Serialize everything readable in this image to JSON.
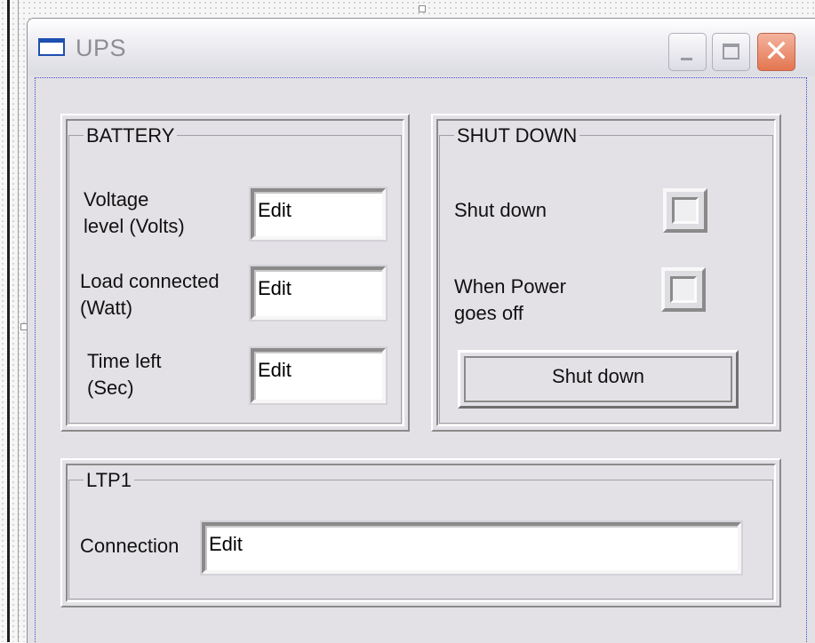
{
  "window": {
    "title": "UPS",
    "controls": {
      "minimize": "minimize",
      "maximize": "maximize",
      "close": "✕"
    }
  },
  "battery": {
    "title": "BATTERY",
    "voltage_label_1": "Voltage",
    "voltage_label_2": "level  (Volts)",
    "voltage_value": "Edit",
    "load_label_1": "Load connected",
    "load_label_2": "(Watt)",
    "load_value": "Edit",
    "time_label_1": "Time left",
    "time_label_2": "(Sec)",
    "time_value": "Edit"
  },
  "shutdown": {
    "title": "SHUT DOWN",
    "shutdown_label": "Shut down",
    "power_label_1": "When Power",
    "power_label_2": "goes off",
    "button_label": "Shut down"
  },
  "ltp": {
    "title": "LTP1",
    "connection_label": "Connection",
    "connection_value": "Edit"
  }
}
